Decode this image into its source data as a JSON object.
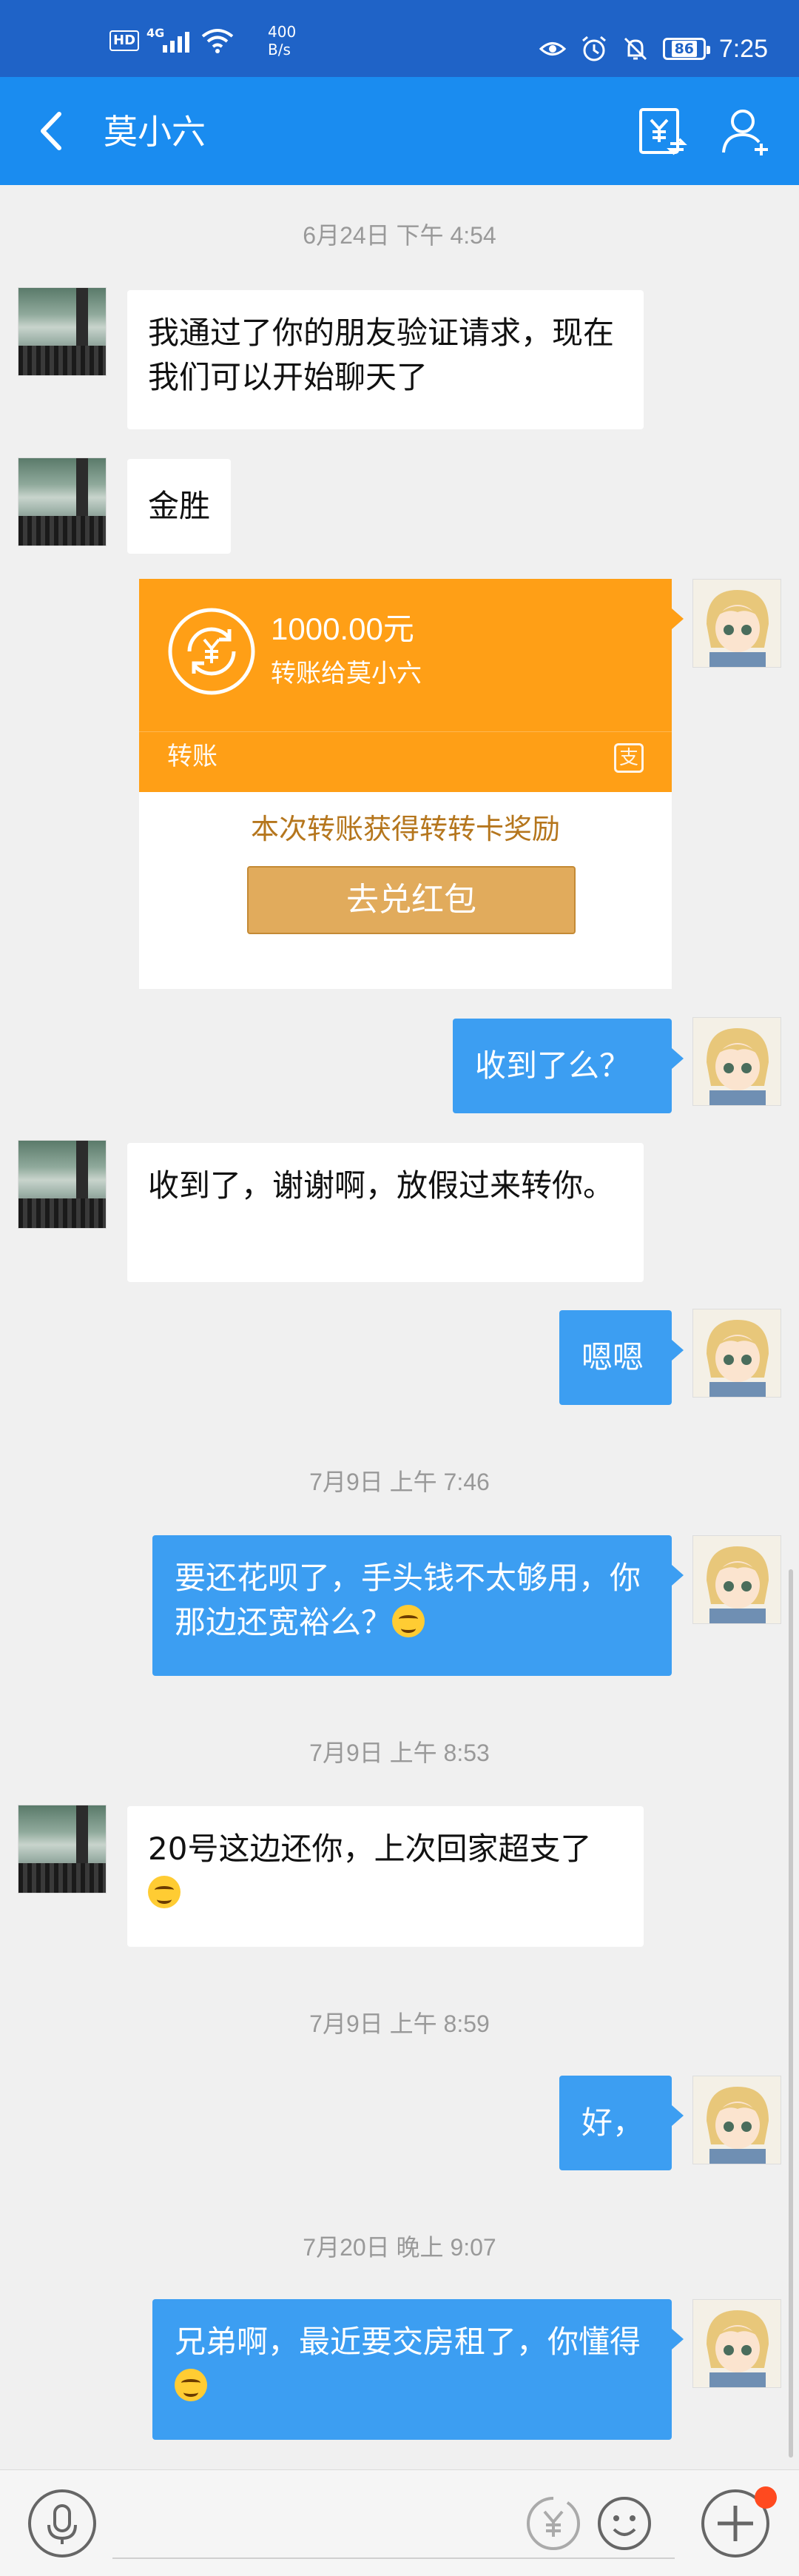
{
  "status_bar": {
    "hd": "HD",
    "network": "4G",
    "speed_value": "400",
    "speed_unit": "B/s",
    "battery": "86",
    "time": "7:25"
  },
  "nav": {
    "title": "莫小六"
  },
  "messages": [
    {
      "type": "timestamp",
      "text": "6月24日 下午 4:54"
    },
    {
      "type": "in",
      "text": "我通过了你的朋友验证请求，现在我们可以开始聊天了"
    },
    {
      "type": "in",
      "text": "金胜"
    },
    {
      "type": "transfer",
      "amount": "1000.00元",
      "to": "转账给莫小六",
      "label": "转账",
      "reward": "本次转账获得转转卡奖励",
      "button": "去兑红包"
    },
    {
      "type": "out",
      "text": "收到了么？"
    },
    {
      "type": "in",
      "text": "收到了，谢谢啊，放假过来转你。"
    },
    {
      "type": "out",
      "text": "嗯嗯"
    },
    {
      "type": "timestamp",
      "text": "7月9日 上午 7:46"
    },
    {
      "type": "out",
      "text": "要还花呗了，手头钱不太够用，你那边还宽裕么？"
    },
    {
      "type": "timestamp",
      "text": "7月9日 上午 8:53"
    },
    {
      "type": "in",
      "text": "20号这边还你，上次回家超支了"
    },
    {
      "type": "timestamp",
      "text": "7月9日 上午 8:59"
    },
    {
      "type": "out",
      "text": "好，"
    },
    {
      "type": "timestamp",
      "text": "7月20日 晚上 9:07"
    },
    {
      "type": "out",
      "text": "兄弟啊，最近要交房租了，你懂得"
    }
  ],
  "icons": {
    "transfer": "yuan-circle-icon",
    "alipay": "alipay-logo-icon",
    "voice": "microphone-icon",
    "money": "yuan-icon",
    "emoji": "smiley-icon",
    "more": "plus-circle-icon"
  },
  "colors": {
    "status_bar": "#1f63c7",
    "nav_bar": "#1a8cf0",
    "outgoing_bubble": "#3c9ef2",
    "transfer_card": "#ff9f16",
    "redeem_button": "#e1ab5c",
    "notification_dot": "#ff4a1f"
  }
}
